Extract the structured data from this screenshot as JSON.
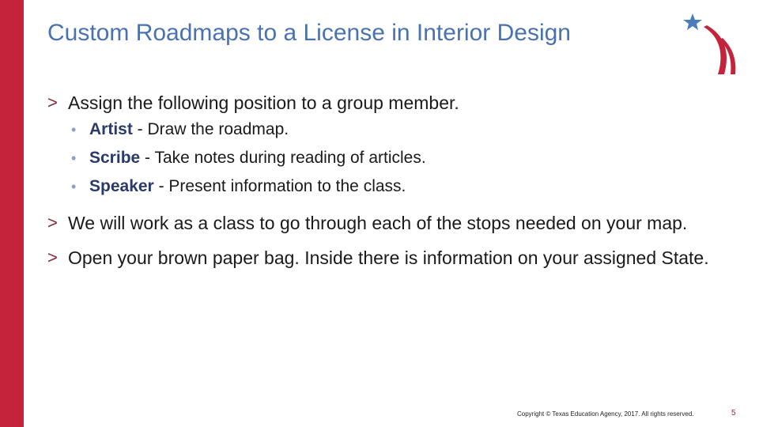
{
  "title": "Custom Roadmaps to a License in Interior Design",
  "colors": {
    "sidebar": "#c4233b",
    "title": "#4a72b0",
    "star": "#4a7cc0",
    "stripe": "#c4233b"
  },
  "logo": {
    "icon": "star-and-stripes-logo"
  },
  "bullets": [
    {
      "text": "Assign the following position to a group member.",
      "sub": [
        {
          "term": "Artist",
          "rest": " - Draw the roadmap."
        },
        {
          "term": "Scribe",
          "rest": " - Take notes during reading of articles."
        },
        {
          "term": "Speaker",
          "rest": " - Present information to the class."
        }
      ]
    },
    {
      "text": "We will work as a class to go through each of the stops needed on your map."
    },
    {
      "text": "Open your brown paper bag. Inside there is information on your assigned State."
    }
  ],
  "footer": {
    "copyright": "Copyright © Texas Education Agency, 2017. All rights reserved.",
    "page": "5"
  }
}
